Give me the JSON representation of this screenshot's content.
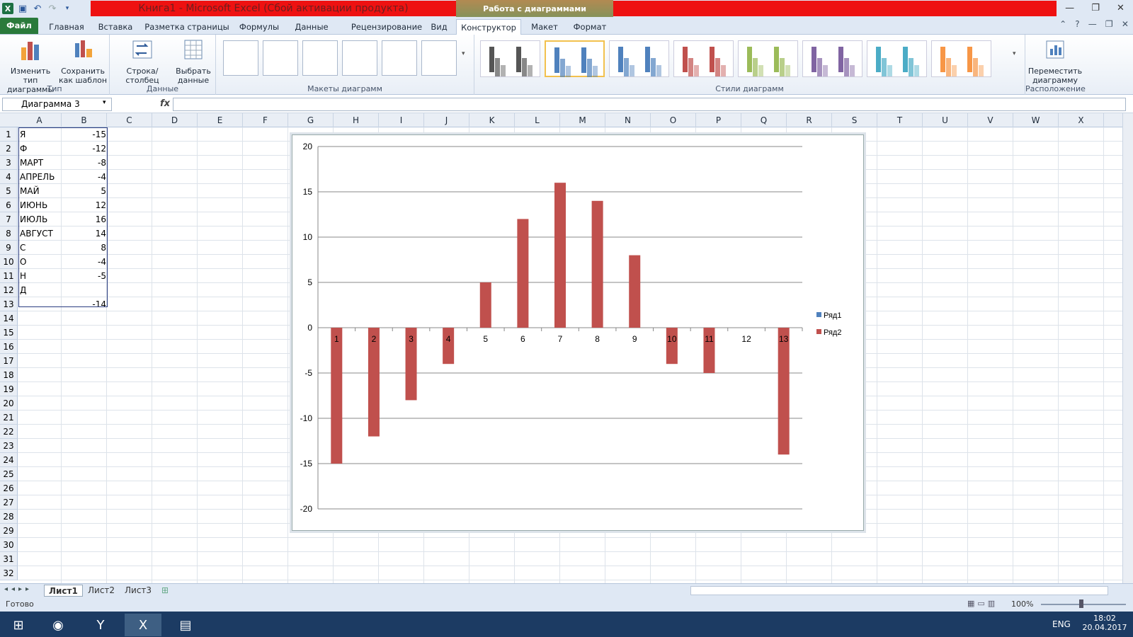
{
  "window": {
    "title": "Книга1 - Microsoft Excel (Сбой активации продукта)",
    "context_title": "Работа с диаграммами",
    "controls": [
      "—",
      "❐",
      "✕"
    ]
  },
  "tabs": [
    "Файл",
    "Главная",
    "Вставка",
    "Разметка страницы",
    "Формулы",
    "Данные",
    "Рецензирование",
    "Вид",
    "Конструктор",
    "Макет",
    "Формат"
  ],
  "ribbon": {
    "type_group": {
      "label": "Тип",
      "change_type": "Изменить тип диаграммы",
      "save_template": "Сохранить как шаблон"
    },
    "data_group": {
      "label": "Данные",
      "row_col": "Строка/столбец",
      "select_data": "Выбрать данные"
    },
    "layouts_group": {
      "label": "Макеты диаграмм"
    },
    "styles_group": {
      "label": "Стили диаграмм",
      "colors": [
        "#555555",
        "#4f81bd",
        "#4f81bd",
        "#c0504d",
        "#9bbb59",
        "#8064a2",
        "#4bacc6",
        "#f79646"
      ]
    },
    "location_group": {
      "label": "Расположение",
      "move_chart": "Переместить диаграмму"
    }
  },
  "formula_bar": {
    "name_box": "Диаграмма 3",
    "fx": "fx",
    "value": ""
  },
  "columns": [
    "A",
    "B",
    "C",
    "D",
    "E",
    "F",
    "G",
    "H",
    "I",
    "J",
    "K",
    "L",
    "M",
    "N",
    "O",
    "P",
    "Q",
    "R",
    "S",
    "T",
    "U",
    "V",
    "W",
    "X"
  ],
  "rows": [
    "1",
    "2",
    "3",
    "4",
    "5",
    "6",
    "7",
    "8",
    "9",
    "10",
    "11",
    "12",
    "13",
    "14",
    "15",
    "16",
    "17",
    "18",
    "19",
    "20",
    "21",
    "22",
    "23",
    "24",
    "25",
    "26",
    "27",
    "28",
    "29",
    "30",
    "31",
    "32"
  ],
  "cells": [
    {
      "a": "Я",
      "b": "-15"
    },
    {
      "a": "Ф",
      "b": "-12"
    },
    {
      "a": "МАРТ",
      "b": "-8"
    },
    {
      "a": "АПРЕЛЬ",
      "b": "-4"
    },
    {
      "a": "МАЙ",
      "b": "5"
    },
    {
      "a": "ИЮНЬ",
      "b": "12"
    },
    {
      "a": "ИЮЛЬ",
      "b": "16"
    },
    {
      "a": "АВГУСТ",
      "b": "14"
    },
    {
      "a": "С",
      "b": "8"
    },
    {
      "a": "О",
      "b": "-4"
    },
    {
      "a": "Н",
      "b": "-5"
    },
    {
      "a": "Д",
      "b": ""
    },
    {
      "a": "",
      "b": "-14"
    }
  ],
  "chart_data": {
    "type": "bar",
    "categories": [
      "1",
      "2",
      "3",
      "4",
      "5",
      "6",
      "7",
      "8",
      "9",
      "10",
      "11",
      "12",
      "13"
    ],
    "series": [
      {
        "name": "Ряд1",
        "values": [],
        "color": "#4f81bd"
      },
      {
        "name": "Ряд2",
        "values": [
          -15,
          -12,
          -8,
          -4,
          5,
          12,
          16,
          14,
          8,
          -4,
          -5,
          null,
          -14
        ],
        "color": "#c0504d"
      }
    ],
    "ylim": [
      -20,
      20
    ],
    "yticks": [
      "20",
      "15",
      "10",
      "5",
      "0",
      "-5",
      "-10",
      "-15",
      "-20"
    ],
    "grid": true,
    "legend": "right"
  },
  "sheets": [
    "Лист1",
    "Лист2",
    "Лист3"
  ],
  "status": {
    "ready": "Готово",
    "zoom": "100%"
  },
  "taskbar": {
    "lang": "ENG",
    "time": "18:02",
    "date": "20.04.2017"
  }
}
